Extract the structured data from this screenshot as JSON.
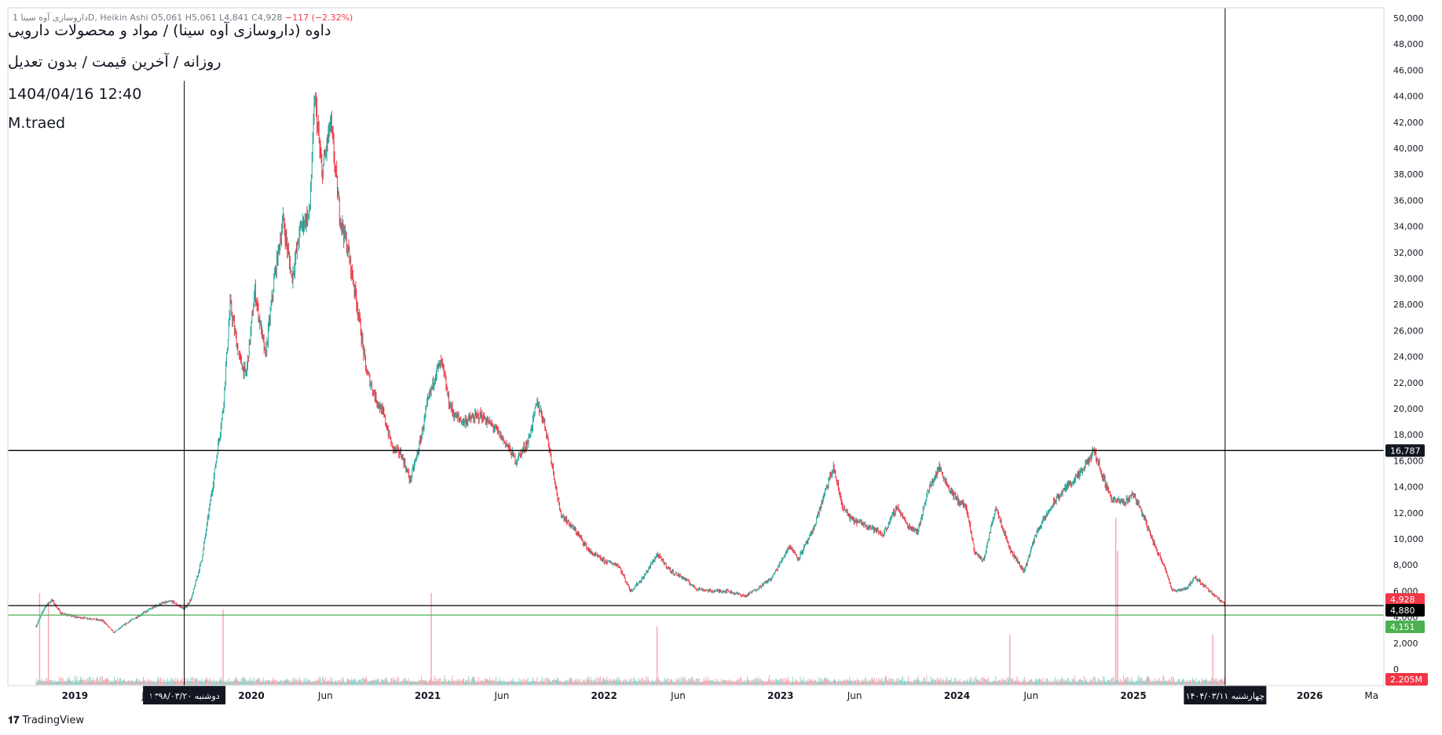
{
  "header": {
    "symbol_line": "داروسازی آوه سینا 1D, Heikin Ashi",
    "ohlc": "O5,061 H5,061 L4,841 C4,928",
    "change": "−117 (−2.32%)",
    "title": "داوه (داروسازی آوه سینا) / مواد و محصولات دارویی",
    "subtitle": "روزانه / آخرین قیمت / بدون تعدیل",
    "datetime": "1404/04/16 12:40",
    "author": "M.traed"
  },
  "footer": {
    "brand": "TradingView"
  },
  "colors": {
    "up": "#26a69a",
    "down": "#f23645",
    "up_volume": "#8ad3cb",
    "down_volume": "#f7a9b0",
    "support_green": "#4caf50",
    "line_black": "#000000",
    "axis_text": "#131722"
  },
  "chart_data": {
    "type": "candlestick",
    "style": "Heikin Ashi",
    "interval": "1D",
    "ylim": [
      0,
      50000
    ],
    "grid": false,
    "y_ticks": [
      "50,000",
      "48,000",
      "46,000",
      "44,000",
      "42,000",
      "40,000",
      "38,000",
      "36,000",
      "34,000",
      "32,000",
      "30,000",
      "28,000",
      "26,000",
      "24,000",
      "22,000",
      "20,000",
      "18,000",
      "16,000",
      "14,000",
      "12,000",
      "10,000",
      "8,000",
      "6,000",
      "4,000",
      "2,000",
      "0"
    ],
    "x_ticks": [
      {
        "label": "2019",
        "t": 2019.0
      },
      {
        "label": "Jun",
        "t": 2019.42
      },
      {
        "label": "2020",
        "t": 2020.0
      },
      {
        "label": "Jun",
        "t": 2020.42
      },
      {
        "label": "2021",
        "t": 2021.0
      },
      {
        "label": "Jun",
        "t": 2021.42
      },
      {
        "label": "2022",
        "t": 2022.0
      },
      {
        "label": "Jun",
        "t": 2022.42
      },
      {
        "label": "2023",
        "t": 2023.0
      },
      {
        "label": "Jun",
        "t": 2023.42
      },
      {
        "label": "2024",
        "t": 2024.0
      },
      {
        "label": "Jun",
        "t": 2024.42
      },
      {
        "label": "2025",
        "t": 2025.0
      },
      {
        "label": "2026",
        "t": 2026.0
      },
      {
        "label": "Ma",
        "t": 2026.35
      }
    ],
    "price_path": [
      [
        2018.78,
        3300
      ],
      [
        2018.83,
        4800
      ],
      [
        2018.87,
        5300
      ],
      [
        2018.92,
        4300
      ],
      [
        2019.0,
        4000
      ],
      [
        2019.08,
        3900
      ],
      [
        2019.16,
        3700
      ],
      [
        2019.22,
        2800
      ],
      [
        2019.3,
        3600
      ],
      [
        2019.4,
        4400
      ],
      [
        2019.48,
        5000
      ],
      [
        2019.55,
        5200
      ],
      [
        2019.62,
        4600
      ],
      [
        2019.66,
        5400
      ],
      [
        2019.72,
        8500
      ],
      [
        2019.78,
        14000
      ],
      [
        2019.84,
        20000
      ],
      [
        2019.88,
        28000
      ],
      [
        2019.93,
        24000
      ],
      [
        2019.97,
        22500
      ],
      [
        2020.02,
        29000
      ],
      [
        2020.08,
        24000
      ],
      [
        2020.13,
        30000
      ],
      [
        2020.18,
        34500
      ],
      [
        2020.23,
        30000
      ],
      [
        2020.28,
        34000
      ],
      [
        2020.33,
        35000
      ],
      [
        2020.36,
        44000
      ],
      [
        2020.4,
        38000
      ],
      [
        2020.45,
        42000
      ],
      [
        2020.5,
        35000
      ],
      [
        2020.55,
        32000
      ],
      [
        2020.6,
        28000
      ],
      [
        2020.65,
        23000
      ],
      [
        2020.7,
        21000
      ],
      [
        2020.75,
        19500
      ],
      [
        2020.8,
        17000
      ],
      [
        2020.85,
        16500
      ],
      [
        2020.9,
        14500
      ],
      [
        2020.95,
        17000
      ],
      [
        2021.0,
        20500
      ],
      [
        2021.05,
        23000
      ],
      [
        2021.08,
        23500
      ],
      [
        2021.12,
        20500
      ],
      [
        2021.15,
        19500
      ],
      [
        2021.2,
        19000
      ],
      [
        2021.3,
        19500
      ],
      [
        2021.38,
        18500
      ],
      [
        2021.45,
        17200
      ],
      [
        2021.5,
        16000
      ],
      [
        2021.57,
        17500
      ],
      [
        2021.62,
        20500
      ],
      [
        2021.66,
        19000
      ],
      [
        2021.7,
        16200
      ],
      [
        2021.75,
        12000
      ],
      [
        2021.8,
        11200
      ],
      [
        2021.85,
        10400
      ],
      [
        2021.92,
        9000
      ],
      [
        2022.0,
        8300
      ],
      [
        2022.08,
        8000
      ],
      [
        2022.15,
        6000
      ],
      [
        2022.22,
        7000
      ],
      [
        2022.3,
        8800
      ],
      [
        2022.38,
        7500
      ],
      [
        2022.45,
        7000
      ],
      [
        2022.52,
        6200
      ],
      [
        2022.6,
        6000
      ],
      [
        2022.7,
        6000
      ],
      [
        2022.8,
        5600
      ],
      [
        2022.88,
        6300
      ],
      [
        2022.95,
        7000
      ],
      [
        2023.0,
        8200
      ],
      [
        2023.05,
        9500
      ],
      [
        2023.1,
        8500
      ],
      [
        2023.18,
        10500
      ],
      [
        2023.25,
        13500
      ],
      [
        2023.3,
        15500
      ],
      [
        2023.35,
        12500
      ],
      [
        2023.4,
        11500
      ],
      [
        2023.5,
        11000
      ],
      [
        2023.58,
        10300
      ],
      [
        2023.66,
        12500
      ],
      [
        2023.72,
        11000
      ],
      [
        2023.78,
        10600
      ],
      [
        2023.83,
        13500
      ],
      [
        2023.9,
        15500
      ],
      [
        2023.95,
        14000
      ],
      [
        2024.0,
        13000
      ],
      [
        2024.05,
        12500
      ],
      [
        2024.1,
        9000
      ],
      [
        2024.15,
        8300
      ],
      [
        2024.22,
        12500
      ],
      [
        2024.3,
        9200
      ],
      [
        2024.38,
        7500
      ],
      [
        2024.45,
        10500
      ],
      [
        2024.55,
        12800
      ],
      [
        2024.62,
        14000
      ],
      [
        2024.7,
        15000
      ],
      [
        2024.78,
        16800
      ],
      [
        2024.82,
        15000
      ],
      [
        2024.88,
        13000
      ],
      [
        2024.95,
        12800
      ],
      [
        2025.0,
        13500
      ],
      [
        2025.05,
        12000
      ],
      [
        2025.12,
        9500
      ],
      [
        2025.18,
        7800
      ],
      [
        2025.22,
        6000
      ],
      [
        2025.3,
        6200
      ],
      [
        2025.35,
        7000
      ],
      [
        2025.42,
        6200
      ],
      [
        2025.48,
        5400
      ],
      [
        2025.52,
        4928
      ]
    ],
    "horizontal_lines": [
      {
        "price": 16787,
        "color": "#000000",
        "label": "16,787"
      },
      {
        "price": 4880,
        "color": "#000000",
        "label": "4,880"
      },
      {
        "price": 4151,
        "color": "#4caf50",
        "label": "4,151"
      }
    ],
    "vertical_lines": [
      {
        "t": 2019.62,
        "label": "دوشنبه ۱۳۹۸/۰۳/۲۰"
      },
      {
        "t": 2025.52,
        "label": "چهارشنبه ۱۴۰۴/۰۳/۱۱"
      }
    ],
    "price_labels": [
      {
        "price": 4928,
        "label": "4,928",
        "color": "#f23645"
      },
      {
        "price": 4880,
        "label": "4,880",
        "color": "#000000"
      },
      {
        "price": 4151,
        "label": "4,151",
        "color": "#4caf50"
      }
    ],
    "volume_label": "2.205M",
    "volume_spikes": [
      {
        "t": 2018.8,
        "v": 0.55
      },
      {
        "t": 2018.85,
        "v": 0.5
      },
      {
        "t": 2019.84,
        "v": 0.45
      },
      {
        "t": 2021.02,
        "v": 0.55
      },
      {
        "t": 2022.3,
        "v": 0.35
      },
      {
        "t": 2024.3,
        "v": 0.3
      },
      {
        "t": 2024.9,
        "v": 1.0
      },
      {
        "t": 2024.91,
        "v": 0.8
      },
      {
        "t": 2025.45,
        "v": 0.3
      }
    ]
  }
}
